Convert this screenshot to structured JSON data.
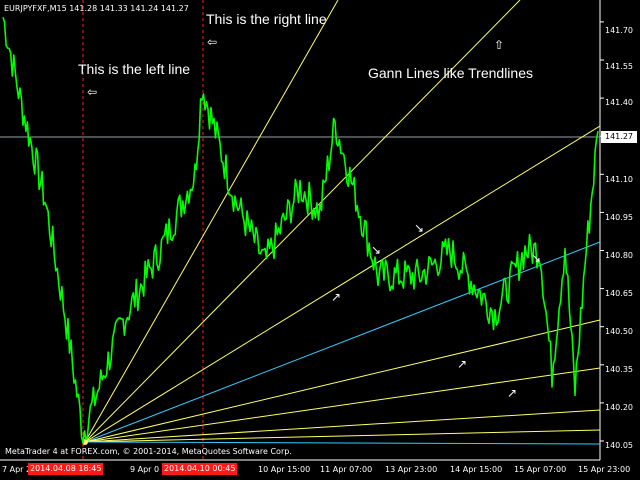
{
  "title": "EURJPYFXF,M15  141.28 141.33 141.24 141.27",
  "annotations": {
    "left_line": "This is the left line",
    "right_line": "This is the right line",
    "gann": "Gann Lines like Trendlines"
  },
  "footer": "MetaTrader 4 at FOREX.com, © 2001-2014, MetaQuotes Software Corp.",
  "current_price": "141.27",
  "price_axis": [
    "141.70",
    "141.55",
    "141.40",
    "141.25",
    "141.10",
    "140.95",
    "140.80",
    "140.65",
    "140.50",
    "140.35",
    "140.20",
    "140.05"
  ],
  "time_axis": [
    "7 Apr 2014",
    "9 Apr 0",
    "10 Apr 15:00",
    "11 Apr 07:00",
    "13 Apr 23:00",
    "14 Apr 15:00",
    "15 Apr 07:00",
    "15 Apr 23:00"
  ],
  "time_markers": [
    "2014.04.08 18:45",
    "2014.04.10 00:45"
  ],
  "icons": [
    "arrow-left-icon",
    "arrow-left-icon",
    "arrow-up-icon",
    "arrow-down-right-icon",
    "arrow-up-right-icon"
  ],
  "colors": {
    "background": "#000000",
    "price": "#00ff00",
    "gann_lines": "#ffff66",
    "cyan_lines": "#33ccff",
    "time_markers": "#ff2020",
    "axis_text": "#ffffff"
  },
  "chart_data": {
    "type": "line",
    "title": "EURJPYFXF,M15  141.28 141.33 141.24 141.27",
    "ylim": [
      140.02,
      141.76
    ],
    "x": [
      "7 Apr",
      "7 Apr",
      "8 Apr",
      "8 Apr",
      "8 Apr",
      "9 Apr",
      "9 Apr",
      "9 Apr",
      "10 Apr",
      "10 Apr",
      "10 Apr",
      "11 Apr",
      "11 Apr",
      "11 Apr",
      "13 Apr",
      "13 Apr",
      "14 Apr",
      "14 Apr",
      "14 Apr",
      "14 Apr",
      "15 Apr",
      "15 Apr",
      "15 Apr",
      "15 Apr",
      "15 Apr"
    ],
    "series": [
      {
        "values": [
          141.72,
          141.4,
          141.0,
          140.55,
          140.08,
          140.5,
          140.8,
          141.1,
          141.45,
          141.0,
          140.75,
          141.05,
          140.95,
          141.3,
          140.7,
          140.7,
          140.8,
          140.55,
          140.8,
          140.8,
          140.32,
          140.82,
          140.25,
          140.75,
          141.27
        ]
      }
    ],
    "current_price": 141.27
  }
}
